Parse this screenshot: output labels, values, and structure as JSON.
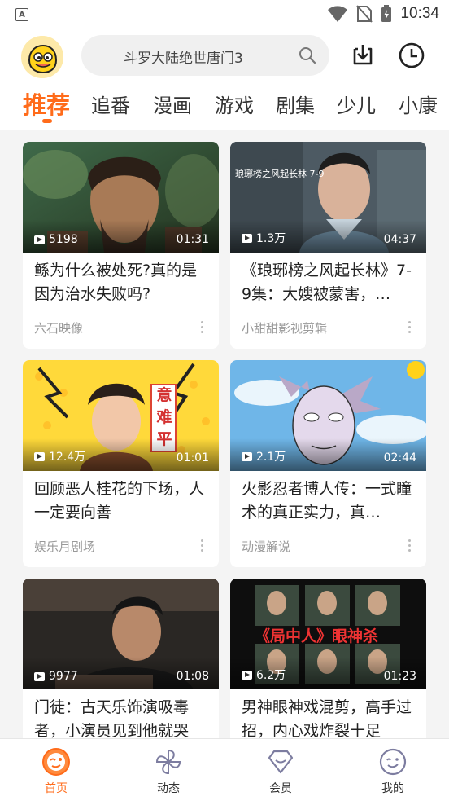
{
  "status_bar": {
    "time": "10:34"
  },
  "search": {
    "placeholder": "斗罗大陆绝世唐门3"
  },
  "tabs": [
    {
      "label": "推荐"
    },
    {
      "label": "追番"
    },
    {
      "label": "漫画"
    },
    {
      "label": "游戏"
    },
    {
      "label": "剧集"
    },
    {
      "label": "少儿"
    },
    {
      "label": "小康"
    }
  ],
  "cards": [
    {
      "views": "5198",
      "duration": "01:31",
      "title": "鲧为什么被处死?真的是因为治水失败吗?",
      "author": "六石映像"
    },
    {
      "views": "1.3万",
      "duration": "04:37",
      "title": "《琅琊榜之风起长林》7-9集：大嫂被蒙害，…",
      "author": "小甜甜影视剪辑",
      "thumb_text": "琅琊榜之风起长林 7-9"
    },
    {
      "views": "12.4万",
      "duration": "01:01",
      "title": "回顾恶人桂花的下场，人一定要向善",
      "author": "娱乐月剧场",
      "thumb_text": "意难平"
    },
    {
      "views": "2.1万",
      "duration": "02:44",
      "title": "火影忍者博人传：一式瞳术的真正实力，真…",
      "author": "动漫解说"
    },
    {
      "views": "9977",
      "duration": "01:08",
      "title": "门徒：古天乐饰演吸毒者，小演员见到他就哭",
      "author": ""
    },
    {
      "views": "6.2万",
      "duration": "01:23",
      "title": "男神眼神戏混剪，高手过招，内心戏炸裂十足",
      "author": "",
      "thumb_text": "《局中人》眼神杀"
    }
  ],
  "bottom_nav": [
    {
      "label": "首页"
    },
    {
      "label": "动态"
    },
    {
      "label": "会员"
    },
    {
      "label": "我的"
    }
  ],
  "colors": {
    "accent": "#ff6b1a",
    "background": "#f4f4f4"
  }
}
